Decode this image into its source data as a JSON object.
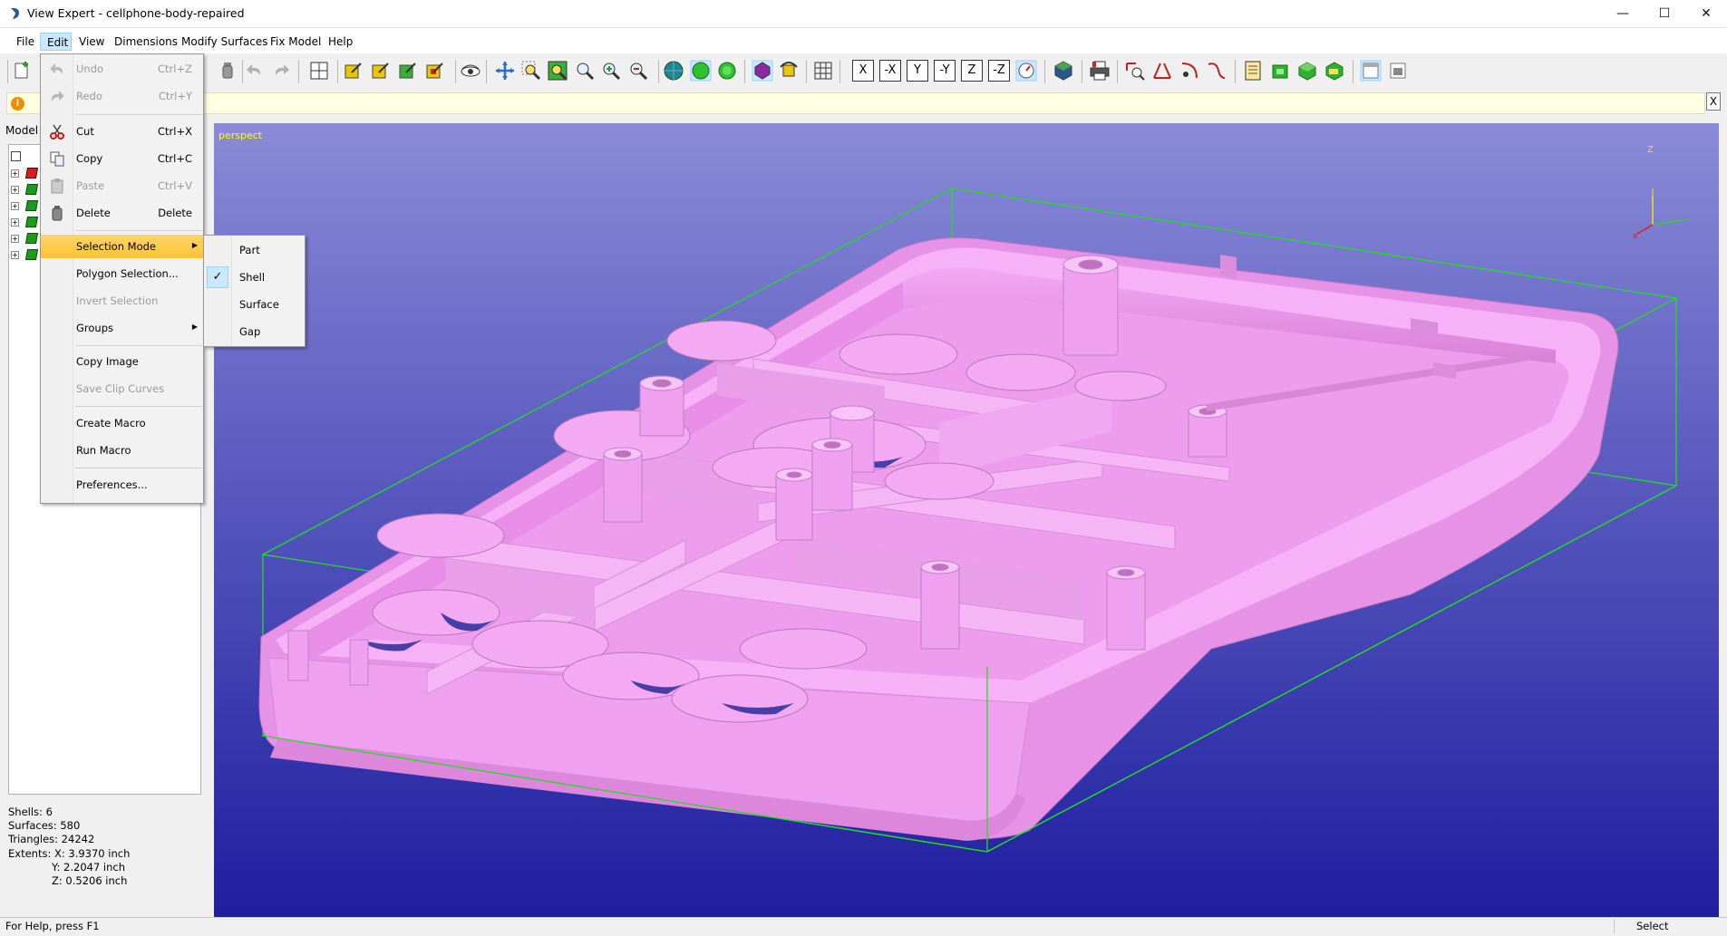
{
  "window": {
    "title": "View Expert - cellphone-body-repaired",
    "controls": {
      "minimize": "—",
      "maximize": "☐",
      "close": "✕"
    }
  },
  "menubar": {
    "items": [
      "File",
      "Edit",
      "View",
      "Dimensions",
      "Modify Surfaces",
      "Fix Model",
      "Help"
    ],
    "active": "Edit"
  },
  "infobar": {
    "close_label": "X",
    "icon": "i"
  },
  "left_panel": {
    "tree_label": "Model T",
    "stats": {
      "shells": "Shells: 6",
      "surfaces": "Surfaces: 580",
      "triangles": "Triangles: 24242",
      "extents_x": "Extents:   X: 3.9370 inch",
      "extents_y": "Y: 2.2047 inch",
      "extents_z": "Z: 0.5206 inch"
    }
  },
  "viewport": {
    "label": "perspect",
    "axis_label": "Z",
    "model_color": "#f09af0",
    "bbox_color": "#22dd22",
    "bg_top": "#8a8ad8",
    "bg_bottom": "#1e1ea0"
  },
  "edit_menu": {
    "undo": {
      "label": "Undo",
      "shortcut": "Ctrl+Z"
    },
    "redo": {
      "label": "Redo",
      "shortcut": "Ctrl+Y"
    },
    "cut": {
      "label": "Cut",
      "shortcut": "Ctrl+X"
    },
    "copy": {
      "label": "Copy",
      "shortcut": "Ctrl+C"
    },
    "paste": {
      "label": "Paste",
      "shortcut": "Ctrl+V"
    },
    "delete": {
      "label": "Delete",
      "shortcut": "Delete"
    },
    "selection_mode": {
      "label": "Selection Mode"
    },
    "polygon_selection": {
      "label": "Polygon Selection..."
    },
    "invert_selection": {
      "label": "Invert Selection"
    },
    "groups": {
      "label": "Groups"
    },
    "copy_image": {
      "label": "Copy Image"
    },
    "save_clip_curves": {
      "label": "Save Clip Curves"
    },
    "create_macro": {
      "label": "Create Macro"
    },
    "run_macro": {
      "label": "Run Macro"
    },
    "preferences": {
      "label": "Preferences..."
    }
  },
  "selection_submenu": {
    "items": [
      "Part",
      "Shell",
      "Surface",
      "Gap"
    ],
    "checked": "Shell",
    "check_mark": "✓"
  },
  "statusbar": {
    "help": "For Help, press F1",
    "mode": "Select"
  },
  "toolbar": {
    "axis_views": [
      "X",
      "-X",
      "Y",
      "-Y",
      "Z",
      "-Z"
    ],
    "icons": [
      "new-icon",
      "open-icon",
      "undo-icon",
      "redo-icon",
      "split-view-icon",
      "part-select-icon",
      "shell-select-icon",
      "surface-select-icon",
      "gap-select-icon",
      "eye-icon",
      "pan-icon",
      "zoom-window-icon",
      "zoom-fit-icon",
      "zoom-icon",
      "zoom-in-icon",
      "zoom-out-icon",
      "wireframe-icon",
      "shaded-icon",
      "shaded-smooth-icon",
      "highlight-icon",
      "rotate-icon",
      "grid-icon",
      "iso-view-icon",
      "render-icon",
      "print-icon",
      "measure-icon",
      "measure-angle-icon",
      "measure-radius-icon",
      "report-icon",
      "fix-icon",
      "box-icon",
      "box-fill-icon",
      "panel-icon",
      "panel-close-icon"
    ]
  }
}
